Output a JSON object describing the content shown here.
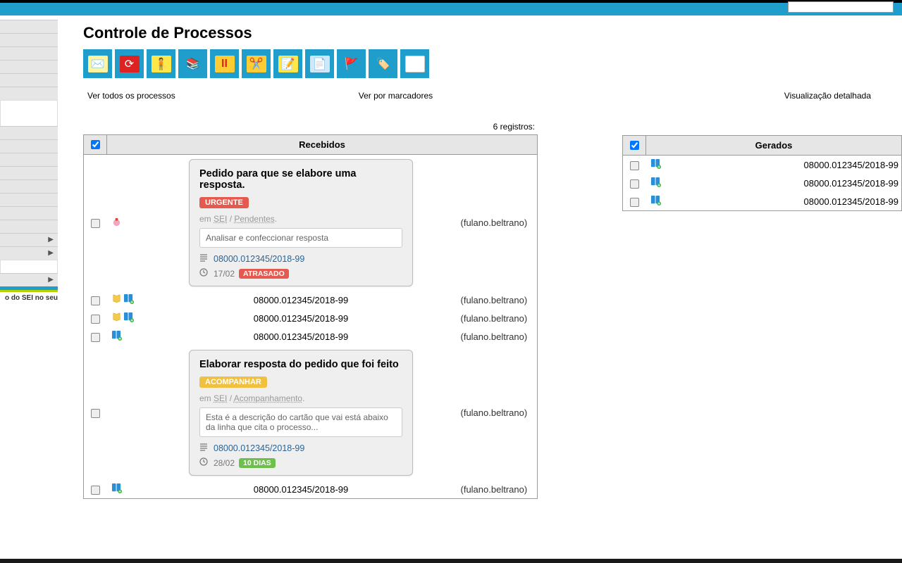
{
  "page_title": "Controle de Processos",
  "side_note": "o do SEI no seu",
  "viewlinks": {
    "all": "Ver todos os processos",
    "markers": "Ver por marcadores",
    "detail": "Visualização detalhada"
  },
  "left": {
    "count": "6 registros:",
    "header": "Recebidos",
    "rows": [
      {
        "kind": "card",
        "user": "(fulano.beltrano)",
        "hasPink": true,
        "card": {
          "title": "Pedido para que se elabore uma resposta.",
          "badge": "URGENTE",
          "badgeClass": "badge-urgent",
          "meta_prefix": "em ",
          "meta_a": "SEI",
          "meta_sep": " / ",
          "meta_b": "Pendentes",
          "meta_suffix": ".",
          "input": "Analisar e confeccionar resposta",
          "proc": "08000.012345/2018-99",
          "date": "17/02",
          "status": "ATRASADO",
          "statusClass": "badge-atrasado"
        }
      },
      {
        "kind": "plain",
        "hasYellow": true,
        "hasBlue": true,
        "proc": "08000.012345/2018-99",
        "user": "(fulano.beltrano)"
      },
      {
        "kind": "plain",
        "hasYellow": true,
        "hasBlue": true,
        "proc": "08000.012345/2018-99",
        "user": "(fulano.beltrano)"
      },
      {
        "kind": "plain",
        "hasYellow": false,
        "hasBlue": true,
        "proc": "08000.012345/2018-99",
        "user": "(fulano.beltrano)"
      },
      {
        "kind": "card",
        "user": "(fulano.beltrano)",
        "hasPink": false,
        "card": {
          "title": "Elaborar resposta do pedido que foi feito",
          "badge": "ACOMPANHAR",
          "badgeClass": "badge-acomp",
          "meta_prefix": "em ",
          "meta_a": "SEI",
          "meta_sep": " / ",
          "meta_b": "Acompanhamento",
          "meta_suffix": ".",
          "input": "Esta é a descrição do cartão que vai está abaixo da linha que cita o processo...",
          "proc": "08000.012345/2018-99",
          "date": "28/02",
          "status": "10 DIAS",
          "statusClass": "badge-dias"
        }
      },
      {
        "kind": "plain",
        "hasYellow": false,
        "hasBlue": true,
        "proc": "08000.012345/2018-99",
        "user": "(fulano.beltrano)"
      }
    ]
  },
  "right": {
    "header": "Gerados",
    "rows": [
      {
        "proc": "08000.012345/2018-99"
      },
      {
        "proc": "08000.012345/2018-99"
      },
      {
        "proc": "08000.012345/2018-99"
      }
    ]
  }
}
